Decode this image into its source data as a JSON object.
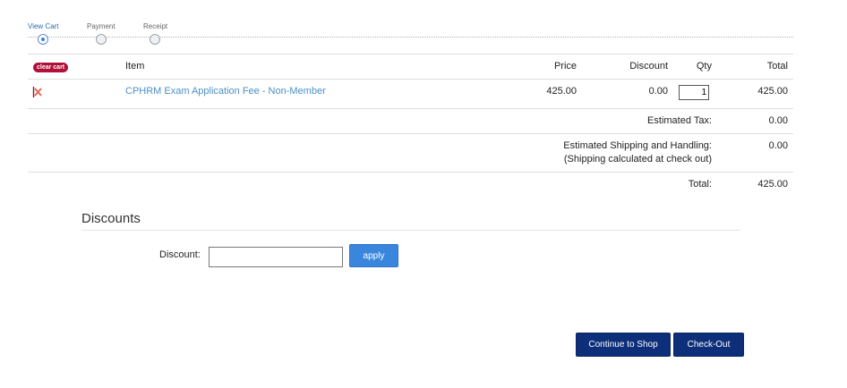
{
  "steps": [
    {
      "label": "View Cart",
      "active": true
    },
    {
      "label": "Payment",
      "active": false
    },
    {
      "label": "Receipt",
      "active": false
    }
  ],
  "cart": {
    "clear_label": "clear cart",
    "headers": {
      "item": "Item",
      "price": "Price",
      "discount": "Discount",
      "qty": "Qty",
      "total": "Total"
    },
    "items": [
      {
        "name": "CPHRM Exam Application Fee - Non-Member",
        "price": "425.00",
        "discount": "0.00",
        "qty": "1",
        "total": "425.00"
      }
    ],
    "summary": {
      "tax_label": "Estimated Tax:",
      "tax_value": "0.00",
      "shipping_label": "Estimated Shipping and Handling:",
      "shipping_note": "(Shipping calculated at check out)",
      "shipping_value": "0.00",
      "total_label": "Total:",
      "total_value": "425.00"
    }
  },
  "discounts": {
    "title": "Discounts",
    "field_label": "Discount:",
    "field_value": "",
    "apply_label": "apply"
  },
  "actions": {
    "continue_label": "Continue to Shop",
    "checkout_label": "Check-Out"
  },
  "colors": {
    "link": "#4a90c8",
    "clear_badge": "#b0103a",
    "apply_button": "#3b86dd",
    "primary_button": "#0d2f7a",
    "remove_icon": "#e06a5a"
  }
}
